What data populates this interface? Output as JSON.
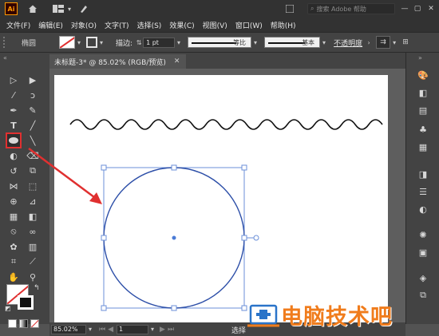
{
  "titlebar": {
    "app_icon": "Ai",
    "search_placeholder": "搜索 Adobe 帮助",
    "icons": [
      "home-icon",
      "workspace-layout-icon",
      "brush-icon",
      "search-icon",
      "minimize-icon",
      "maximize-icon",
      "close-icon"
    ]
  },
  "menubar": {
    "items": [
      "文件(F)",
      "编辑(E)",
      "对象(O)",
      "文字(T)",
      "选择(S)",
      "效果(C)",
      "视图(V)",
      "窗口(W)",
      "帮助(H)"
    ]
  },
  "controlbar": {
    "object_type": "椭圆",
    "stroke_label": "描边:",
    "stroke_value": "1 pt",
    "profile_label": "等比",
    "brush_label": "基本",
    "opacity_label": "不透明度"
  },
  "document": {
    "tab_title": "未标题-3* @ 85.02% (RGB/预览)",
    "tab_close": "✕"
  },
  "statusbar": {
    "zoom": "85.02%",
    "page": "1",
    "status": "选择"
  },
  "watermark": {
    "text": "电脑技术吧"
  },
  "colors": {
    "accent_orange": "#f07c1c",
    "selection_blue": "#4a7bd6",
    "highlight_red": "#e03030"
  }
}
